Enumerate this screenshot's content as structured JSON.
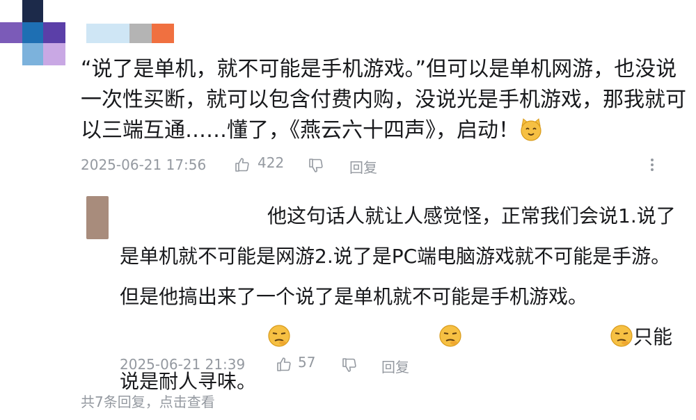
{
  "colors": {
    "text": "#18191c",
    "meta": "#9499a0",
    "avatar_purple": "#7b5bb8",
    "avatar_blue": "#1e6fb3",
    "avatar_navy": "#1c2a4a",
    "avatar_light_blue": "#7cb2dc",
    "avatar_light_purple": "#c9a8e4",
    "reply_avatar": "#a88c7c"
  },
  "comment": {
    "text": "“说了是单机，就不可能是手机游戏。”但可以是单机网游，也没说一次性买断，就可以包含付费内购，没说光是手机游戏，那我就可以三端互通……懂了，《燕云六十四声》，启动！",
    "emoji": "cat-smile-emoji",
    "timestamp": "2025-06-21 17:56",
    "like_count": "422",
    "reply_label": "回复"
  },
  "reply": {
    "text_part1": "他这句话人就让人感觉怪，正常我们会说1.说了是单机就不可能是网游2.说了是PC端电脑游戏就不可能是手游。 但是他搞出来了一个说了是单机就不可能是手机游戏。",
    "emojis": [
      "thinking-emoji",
      "thinking-emoji",
      "thinking-emoji"
    ],
    "text_part2": "只能说是耐人寻味。",
    "timestamp": "2025-06-21 21:39",
    "like_count": "57",
    "reply_label": "回复"
  },
  "footer": {
    "more_replies": "共7条回复，点击查看"
  }
}
